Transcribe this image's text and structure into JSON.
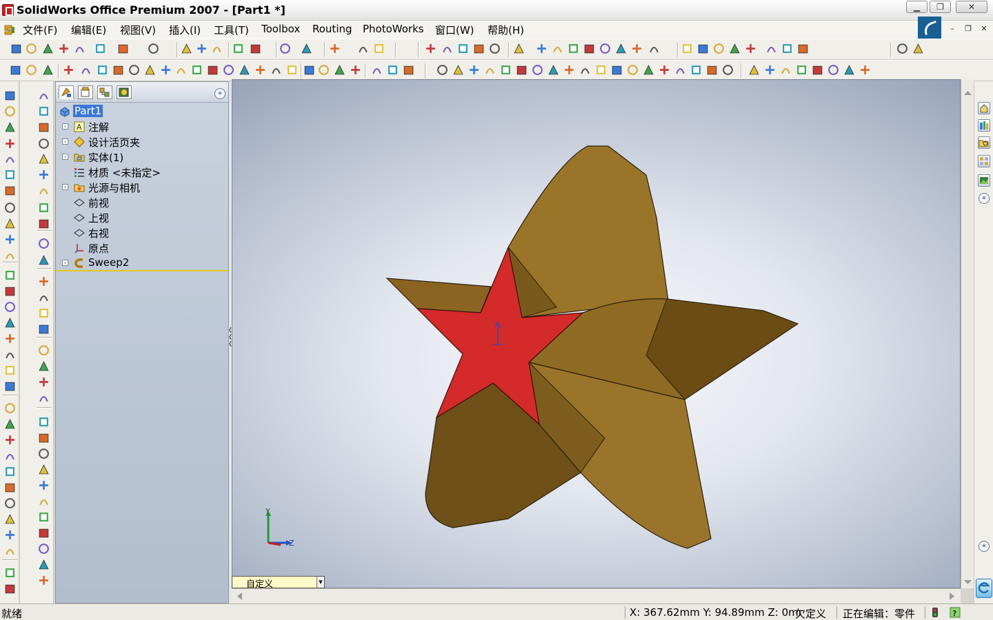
{
  "window": {
    "title": "SolidWorks Office Premium 2007 - [Part1 *]"
  },
  "menu": {
    "items": [
      {
        "label": "文件(F)"
      },
      {
        "label": "编辑(E)"
      },
      {
        "label": "视图(V)"
      },
      {
        "label": "插入(I)"
      },
      {
        "label": "工具(T)"
      },
      {
        "label": "Toolbox"
      },
      {
        "label": "Routing"
      },
      {
        "label": "PhotoWorks"
      },
      {
        "label": "窗口(W)"
      },
      {
        "label": "帮助(H)"
      }
    ]
  },
  "feature_tree": {
    "root": "Part1",
    "items": [
      {
        "label": "注解",
        "icon": "annotations-icon",
        "expandable": true
      },
      {
        "label": "设计活页夹",
        "icon": "design-binder-icon",
        "expandable": true
      },
      {
        "label": "实体(1)",
        "icon": "solid-bodies-icon",
        "expandable": true
      },
      {
        "label": "材质 <未指定>",
        "icon": "material-icon",
        "expandable": false
      },
      {
        "label": "光源与相机",
        "icon": "lights-cameras-icon",
        "expandable": true
      },
      {
        "label": "前视",
        "icon": "plane-icon",
        "expandable": false
      },
      {
        "label": "上视",
        "icon": "plane-icon",
        "expandable": false
      },
      {
        "label": "右视",
        "icon": "plane-icon",
        "expandable": false
      },
      {
        "label": "原点",
        "icon": "origin-icon",
        "expandable": false
      },
      {
        "label": "Sweep2",
        "icon": "sweep-icon",
        "expandable": true
      }
    ]
  },
  "viewport": {
    "view_orientation": "自定义",
    "triad": {
      "y": "Y",
      "z": "Z"
    },
    "colors": {
      "star_face": "#d42a2a",
      "star_body": "#9a7428"
    }
  },
  "status": {
    "left": "就绪",
    "coords": "X: 367.62mm  Y: 94.89mm  Z: 0mı",
    "state": "欠定义",
    "editing": "正在编辑：零件"
  }
}
